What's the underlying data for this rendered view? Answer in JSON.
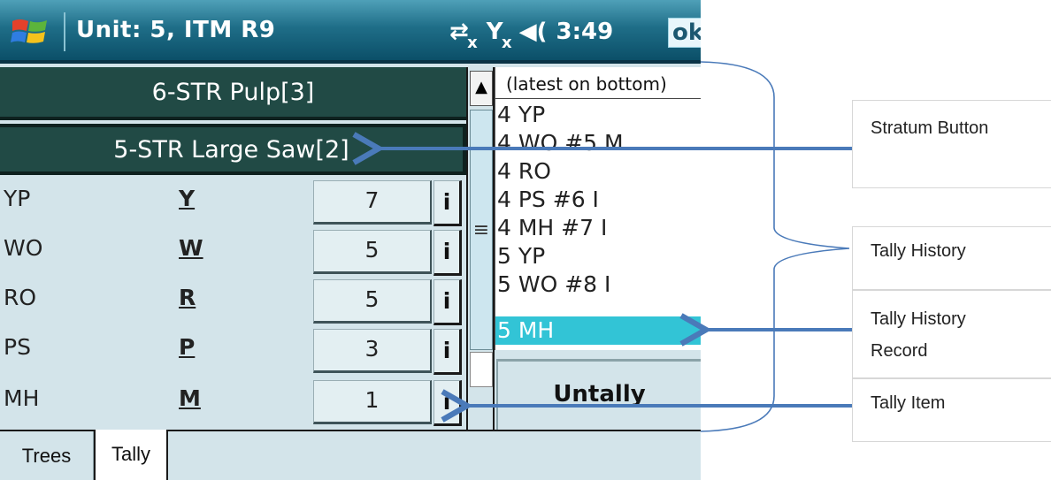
{
  "titlebar": {
    "title": "Unit: 5, ITM R9",
    "time": "3:49",
    "ok_label": "ok"
  },
  "strata": [
    {
      "label": "6-STR Pulp[3]"
    },
    {
      "label": "5-STR Large Saw[2]"
    }
  ],
  "tally_rows": [
    {
      "species": "YP",
      "key": "Y",
      "count": "7",
      "info": "i"
    },
    {
      "species": "WO",
      "key": "W",
      "count": "5",
      "info": "i"
    },
    {
      "species": "RO",
      "key": "R",
      "count": "5",
      "info": "i"
    },
    {
      "species": "PS",
      "key": "P",
      "count": "3",
      "info": "i"
    },
    {
      "species": "MH",
      "key": "M",
      "count": "1",
      "info": "i"
    }
  ],
  "scrollbar": {
    "thumb_glyph": "≡",
    "up_glyph": "▲"
  },
  "history": {
    "header": "(latest on bottom)",
    "items": [
      "4 YP",
      "4 WO #5 M",
      "4 RO",
      "4 PS #6 I",
      "4 MH #7 I",
      "5 YP",
      "5 WO #8 I",
      "5 MH"
    ],
    "selected_index": 7
  },
  "untally_label": "Untally",
  "tabs": {
    "trees": "Trees",
    "tally": "Tally"
  },
  "annotations": {
    "stratum_button": "Stratum Button",
    "tally_history": "Tally History",
    "tally_history_record_line1": "Tally History",
    "tally_history_record_line2": "Record",
    "tally_item": "Tally Item"
  },
  "colors": {
    "stratum_bg": "#214a45",
    "history_selected": "#32c4d6",
    "arrow": "#4a7ab9"
  }
}
